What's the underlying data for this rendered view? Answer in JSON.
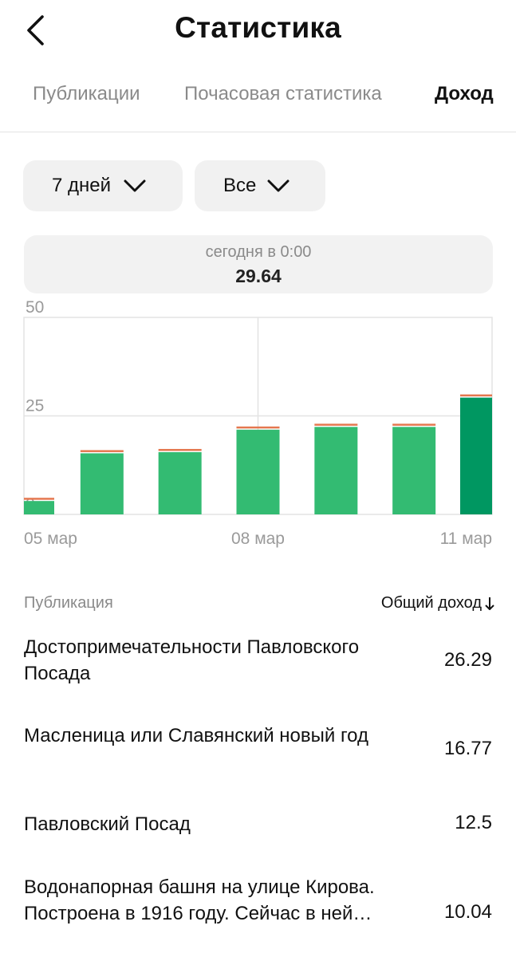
{
  "header": {
    "title": "Статистика",
    "back_icon": "chevron-left-icon"
  },
  "tabs": [
    {
      "label": "Публикации",
      "active": false
    },
    {
      "label": "Почасовая статистика",
      "active": false
    },
    {
      "label": "Доход",
      "active": true
    }
  ],
  "filters": {
    "period": {
      "label": "7 дней",
      "icon": "chevron-down-icon"
    },
    "type": {
      "label": "Все",
      "icon": "chevron-down-icon"
    }
  },
  "tooltip": {
    "time": "сегодня в 0:00",
    "value": "29.64"
  },
  "colors": {
    "bar": "#33bb72",
    "bar_selected": "#009761",
    "bar_cap": "#e4774f",
    "grid": "#e3e3e3",
    "axis_text": "#9a9a9a"
  },
  "chart_data": {
    "type": "bar",
    "categories": [
      "05 мар",
      "06 мар",
      "07 мар",
      "08 мар",
      "09 мар",
      "10 мар",
      "11 мар"
    ],
    "values": [
      3.4,
      15.5,
      15.8,
      21.5,
      22.2,
      22.2,
      29.64
    ],
    "ylim": [
      0,
      50
    ],
    "y_ticks": [
      "50",
      "25",
      "0"
    ],
    "x_tick_labels": [
      "05 мар",
      "08 мар",
      "11 мар"
    ],
    "selected_index": 6,
    "grid": true
  },
  "table": {
    "col_publication": "Публикация",
    "col_income": "Общий доход",
    "sort_icon": "arrow-down-icon",
    "rows": [
      {
        "title": "Достопримечательности Павловского Посада",
        "income": "26.29"
      },
      {
        "title": "Масленица или Славянский новый год",
        "income": "16.77"
      },
      {
        "title": "Павловский Посад",
        "income": "12.5"
      },
      {
        "title": "Водонапорная башня на улице Кирова. Построена в 1916 году. Сейчас в ней…",
        "income": "10.04"
      }
    ]
  }
}
